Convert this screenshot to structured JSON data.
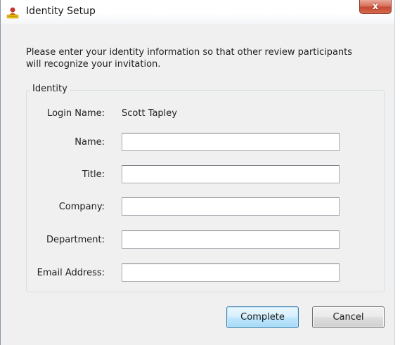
{
  "window": {
    "title": "Identity Setup",
    "close_glyph": "x"
  },
  "intro_text": "Please enter your identity information so that other review participants will recognize your invitation.",
  "identity": {
    "group_label": "Identity",
    "login_name_label": "Login Name:",
    "login_name_value": "Scott Tapley",
    "fields": {
      "name_label": "Name:",
      "name_value": "",
      "title_label": "Title:",
      "title_value": "",
      "company_label": "Company:",
      "company_value": "",
      "department_label": "Department:",
      "department_value": "",
      "email_label": "Email Address:",
      "email_value": ""
    }
  },
  "buttons": {
    "complete_label": "Complete",
    "cancel_label": "Cancel"
  },
  "icons": {
    "app_icon": "identity-app-icon",
    "close_icon": "close-icon"
  },
  "colors": {
    "close_button": "#c54a33",
    "default_button_border": "#3c7fb1",
    "dialog_background": "#f0f0f0"
  }
}
